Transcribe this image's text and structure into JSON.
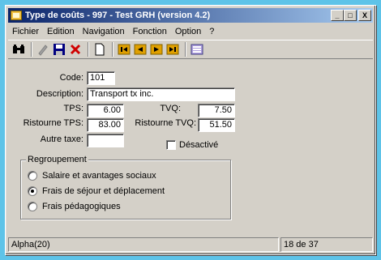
{
  "window": {
    "title": "Type de coûts - 997 - Test GRH (version 4.2)",
    "minimize_glyph": "_",
    "maximize_glyph": "□",
    "close_glyph": "X"
  },
  "menu": [
    "Fichier",
    "Edition",
    "Navigation",
    "Fonction",
    "Option",
    "?"
  ],
  "toolbar": [
    {
      "icon": "binoculars-icon"
    },
    {
      "icon": "pencil-icon"
    },
    {
      "icon": "save-icon"
    },
    {
      "icon": "delete-icon"
    },
    {
      "icon": "new-document-icon"
    },
    {
      "icon": "first-record-icon"
    },
    {
      "icon": "previous-record-icon"
    },
    {
      "icon": "next-record-icon"
    },
    {
      "icon": "last-record-icon"
    },
    {
      "icon": "list-view-icon"
    }
  ],
  "form": {
    "code_label": "Code:",
    "code_value": "101",
    "description_label": "Description:",
    "description_value": "Transport tx inc.",
    "tps_label": "TPS:",
    "tps_value": "6.00",
    "tvq_label": "TVQ:",
    "tvq_value": "7.50",
    "ristourne_tps_label": "Ristourne TPS:",
    "ristourne_tps_value": "83.00",
    "ristourne_tvq_label": "Ristourne TVQ:",
    "ristourne_tvq_value": "51.50",
    "autre_taxe_label": "Autre taxe:",
    "autre_taxe_value": "",
    "desactive_label": "Désactivé",
    "desactive_checked": false
  },
  "regroupement": {
    "legend": "Regroupement",
    "options": [
      {
        "label": "Salaire et avantages sociaux",
        "selected": false
      },
      {
        "label": "Frais de séjour et déplacement",
        "selected": true
      },
      {
        "label": "Frais pédagogiques",
        "selected": false
      }
    ]
  },
  "status": {
    "field_type": "Alpha(20)",
    "record_position": "18 de 37"
  }
}
